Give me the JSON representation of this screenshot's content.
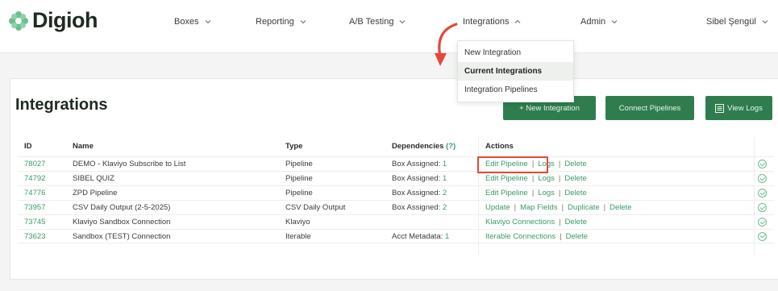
{
  "brand": {
    "name": "Digioh",
    "accent": "#2f7d4f",
    "logo_color": "#6bbf8f"
  },
  "nav": {
    "items": [
      {
        "label": "Boxes",
        "icon": "chevron-down-icon"
      },
      {
        "label": "Reporting",
        "icon": "chevron-down-icon"
      },
      {
        "label": "A/B Testing",
        "icon": "chevron-down-icon"
      },
      {
        "label": "Integrations",
        "icon": "chevron-up-icon"
      },
      {
        "label": "Admin",
        "icon": "chevron-down-icon"
      }
    ],
    "user": {
      "label": "Sibel Şengül",
      "icon": "chevron-down-icon"
    }
  },
  "dropdown": {
    "items": [
      {
        "label": "New Integration"
      },
      {
        "label": "Current Integrations",
        "active": true
      },
      {
        "label": "Integration Pipelines"
      }
    ]
  },
  "page": {
    "title": "Integrations",
    "buttons": {
      "new_integration": "+ New Integration",
      "connect_pipelines": "Connect Pipelines",
      "view_logs": "View Logs"
    }
  },
  "table": {
    "headers": {
      "id": "ID",
      "name": "Name",
      "type": "Type",
      "dependencies": "Dependencies",
      "dependencies_count": "(?)",
      "actions": "Actions"
    },
    "rows": [
      {
        "id": "78027",
        "name": "DEMO - Klaviyo Subscribe to List",
        "type": "Pipeline",
        "dep_label": "Box Assigned:",
        "dep_value": "1",
        "actions": [
          "Edit Pipeline",
          "Logs",
          "Delete"
        ]
      },
      {
        "id": "74792",
        "name": "SIBEL QUIZ",
        "type": "Pipeline",
        "dep_label": "Box Assigned:",
        "dep_value": "1",
        "actions": [
          "Edit Pipeline",
          "Logs",
          "Delete"
        ]
      },
      {
        "id": "74776",
        "name": "ZPD Pipeline",
        "type": "Pipeline",
        "dep_label": "Box Assigned:",
        "dep_value": "2",
        "actions": [
          "Edit Pipeline",
          "Logs",
          "Delete"
        ]
      },
      {
        "id": "73957",
        "name": "CSV Daily Output (2-5-2025)",
        "type": "CSV Daily Output",
        "dep_label": "Box Assigned:",
        "dep_value": "2",
        "actions": [
          "Update",
          "Map Fields",
          "Duplicate",
          "Delete"
        ]
      },
      {
        "id": "73745",
        "name": "Klaviyo Sandbox Connection",
        "type": "Klaviyo",
        "dep_label": "",
        "dep_value": "",
        "actions": [
          "Klaviyo Connections",
          "Delete"
        ]
      },
      {
        "id": "73623",
        "name": "Sandbox (TEST) Connection",
        "type": "Iterable",
        "dep_label": "Acct Metadata:",
        "dep_value": "1",
        "actions": [
          "Iterable Connections",
          "Delete"
        ]
      }
    ]
  }
}
